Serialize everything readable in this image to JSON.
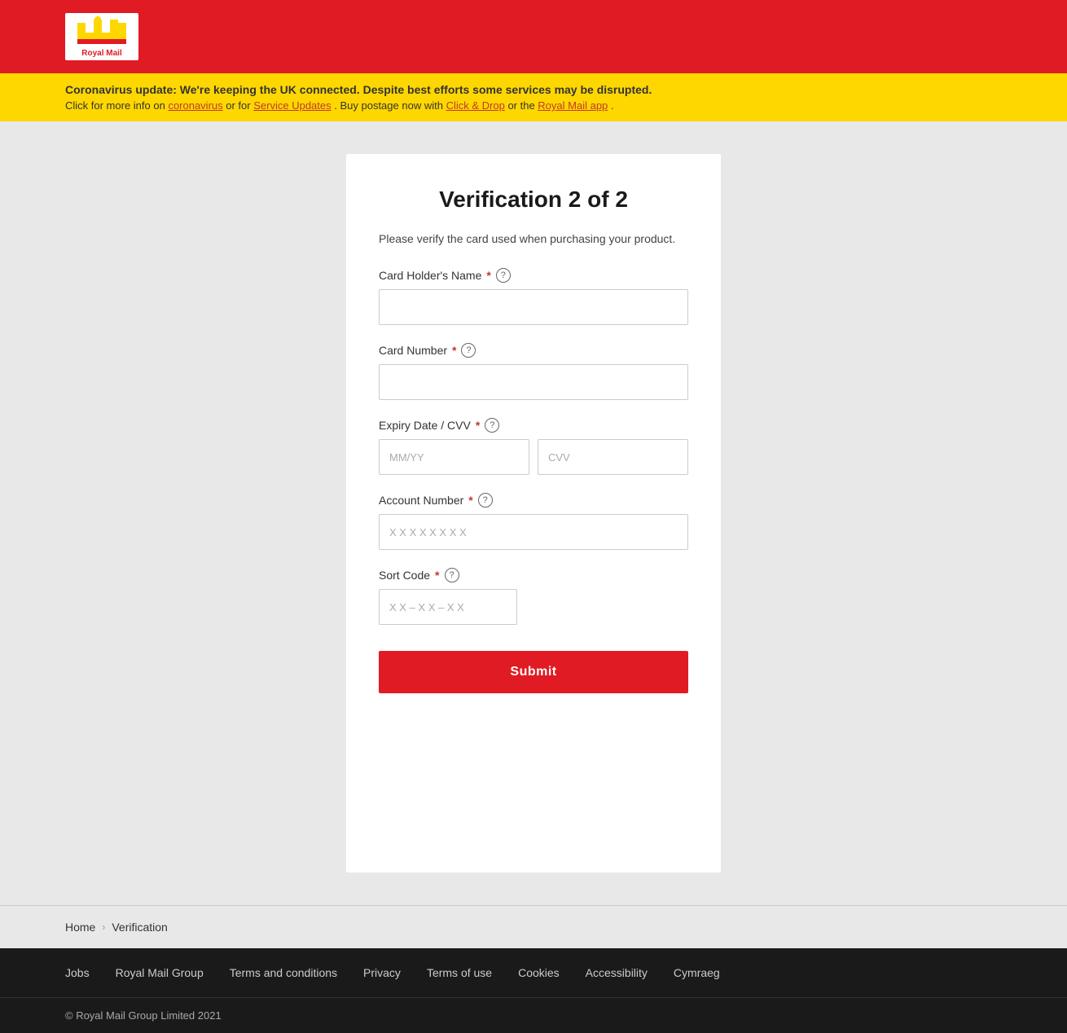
{
  "header": {
    "logo_alt": "Royal Mail",
    "logo_text": "Royal Mail"
  },
  "alert": {
    "title": "Coronavirus update: We're keeping the UK connected. Despite best efforts some services may be disrupted.",
    "body_prefix": "Click for more info on ",
    "link1": "coronavirus",
    "body_middle1": " or for ",
    "link2": "Service Updates",
    "body_middle2": ". Buy postage now with ",
    "link3": "Click & Drop",
    "body_middle3": " or the ",
    "link4": "Royal Mail app",
    "body_suffix": "."
  },
  "form": {
    "title": "Verification 2 of 2",
    "subtitle": "Please verify the card used when purchasing your product.",
    "fields": {
      "card_holder_name": {
        "label": "Card Holder's Name",
        "required": true,
        "placeholder": ""
      },
      "card_number": {
        "label": "Card Number",
        "required": true,
        "placeholder": ""
      },
      "expiry_date": {
        "label": "Expiry Date / CVV",
        "required": true,
        "expiry_placeholder": "MM/YY",
        "cvv_placeholder": "CVV"
      },
      "account_number": {
        "label": "Account Number",
        "required": true,
        "placeholder": "X X X X X X X X"
      },
      "sort_code": {
        "label": "Sort Code",
        "required": true,
        "placeholder": "X X – X X – X X"
      }
    },
    "submit_label": "Submit"
  },
  "breadcrumb": {
    "home_label": "Home",
    "separator": "›",
    "current": "Verification"
  },
  "footer_nav": {
    "links": [
      {
        "label": "Jobs",
        "href": "#"
      },
      {
        "label": "Royal Mail Group",
        "href": "#"
      },
      {
        "label": "Terms and conditions",
        "href": "#"
      },
      {
        "label": "Privacy",
        "href": "#"
      },
      {
        "label": "Terms of use",
        "href": "#"
      },
      {
        "label": "Cookies",
        "href": "#"
      },
      {
        "label": "Accessibility",
        "href": "#"
      },
      {
        "label": "Cymraeg",
        "href": "#"
      }
    ]
  },
  "footer_copyright": {
    "text": "© Royal Mail Group Limited 2021"
  },
  "icons": {
    "help": "?",
    "chevron_right": "›"
  }
}
